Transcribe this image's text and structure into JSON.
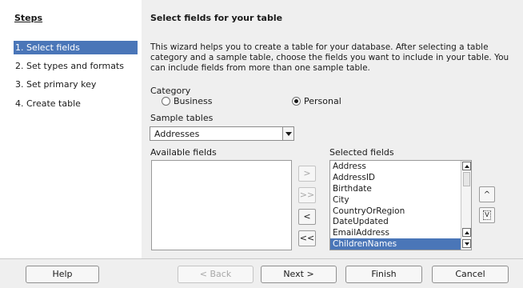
{
  "steps": {
    "title": "Steps",
    "items": [
      {
        "label": "1. Select fields"
      },
      {
        "label": "2. Set types and formats"
      },
      {
        "label": "3. Set primary key"
      },
      {
        "label": "4. Create table"
      }
    ]
  },
  "page": {
    "title": "Select fields for your table",
    "description": "This wizard helps you to create a table for your database. After selecting a table category and a sample table, choose the fields you want to include in your table. You can include fields from more than one sample table."
  },
  "category": {
    "label": "Category",
    "options": [
      {
        "label": "Business",
        "selected": false
      },
      {
        "label": "Personal",
        "selected": true
      }
    ]
  },
  "sample_tables": {
    "label": "Sample tables",
    "value": "Addresses"
  },
  "available_fields": {
    "label": "Available fields",
    "items": []
  },
  "selected_fields": {
    "label": "Selected fields",
    "items": [
      "Address",
      "AddressID",
      "Birthdate",
      "City",
      "CountryOrRegion",
      "DateUpdated",
      "EmailAddress",
      "ChildrenNames"
    ],
    "highlighted": "ChildrenNames"
  },
  "move_buttons": {
    "add_one": ">",
    "add_all": ">>",
    "remove_one": "<",
    "remove_all": "<<"
  },
  "order_buttons": {
    "up": "^",
    "down": "V"
  },
  "footer": {
    "help": "Help",
    "back": "< Back",
    "next": "Next >",
    "finish": "Finish",
    "cancel": "Cancel"
  },
  "colors": {
    "selection": "#4a76b8",
    "dialog_bg": "#efefef"
  }
}
